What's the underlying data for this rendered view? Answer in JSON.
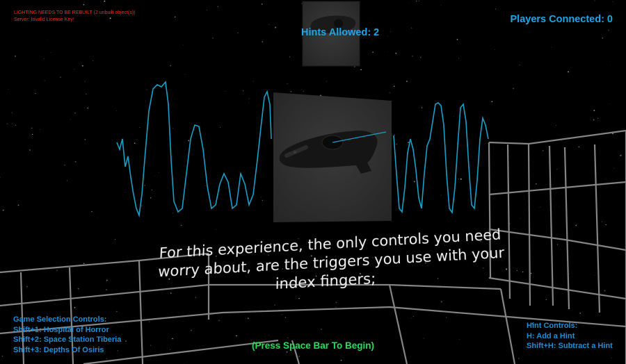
{
  "debug": {
    "line1": "LIGHTING NEEDS TO BE REBUILT (2 unbuilt object(s))",
    "line2": "Server: Invalid License Key!",
    "color": "#ff2a1a"
  },
  "hud": {
    "hints_allowed": "Hints Allowed: 2",
    "players_connected": "Players Connected: 0",
    "color": "#1ea7e8"
  },
  "game_selection": {
    "title": "Game Selection Controls:",
    "items": [
      "Shift+1: Hospital of Horror",
      "Shift+2: Space Station Tiberia",
      "Shift+3: Depths Of Osiris"
    ]
  },
  "hint_controls": {
    "title": "Hint Controls:",
    "items": [
      "H: Add a Hint",
      "Shift+H: Subtract a Hint"
    ]
  },
  "instruction": {
    "lines": [
      "For this experience, the only controls you need",
      "worry about, are the triggers you use with your",
      "index fingers;"
    ]
  },
  "prompt": {
    "text": "(Press Space Bar To Begin)",
    "color": "#22e05a"
  },
  "scene": {
    "waveform_color": "#19a0c8",
    "grid_color": "#8a8a8a",
    "icons": [
      "vive-controller-icon",
      "vive-controller-icon"
    ]
  }
}
